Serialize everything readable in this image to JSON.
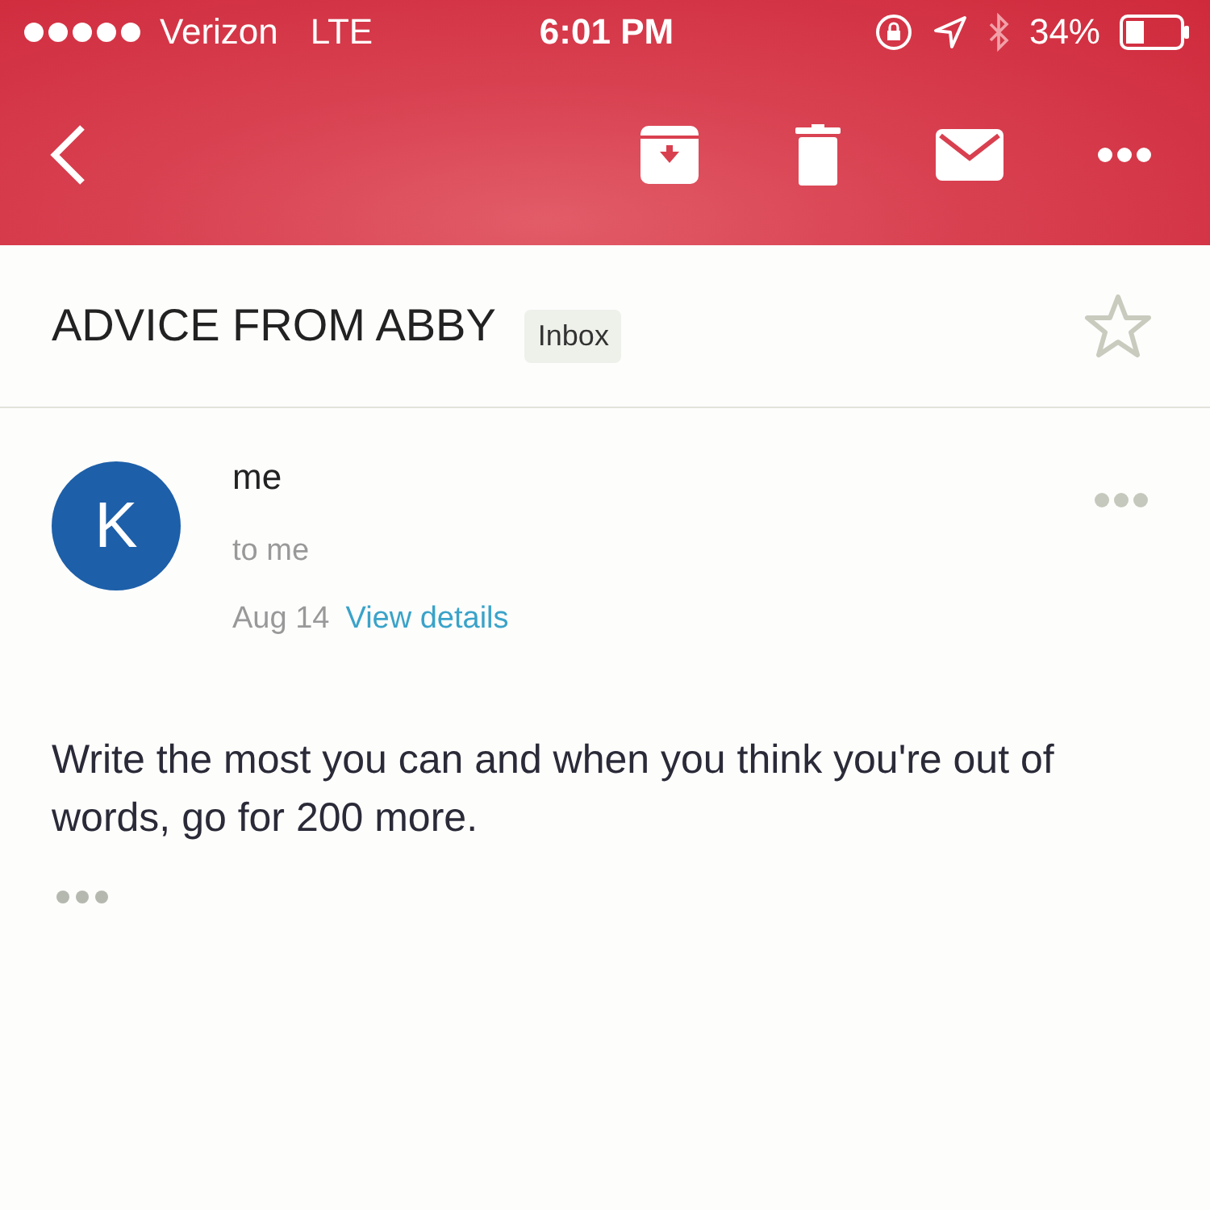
{
  "status_bar": {
    "carrier": "Verizon",
    "network": "LTE",
    "time": "6:01 PM",
    "battery": "34%"
  },
  "subject": {
    "title": "ADVICE FROM ABBY",
    "label": "Inbox",
    "starred": false
  },
  "message": {
    "avatar": "K",
    "sender": "me",
    "recipient": "to me",
    "date": "Aug 14",
    "details_link": "View details",
    "body": "Write the most you can and when you think you're out of words, go for 200 more."
  }
}
